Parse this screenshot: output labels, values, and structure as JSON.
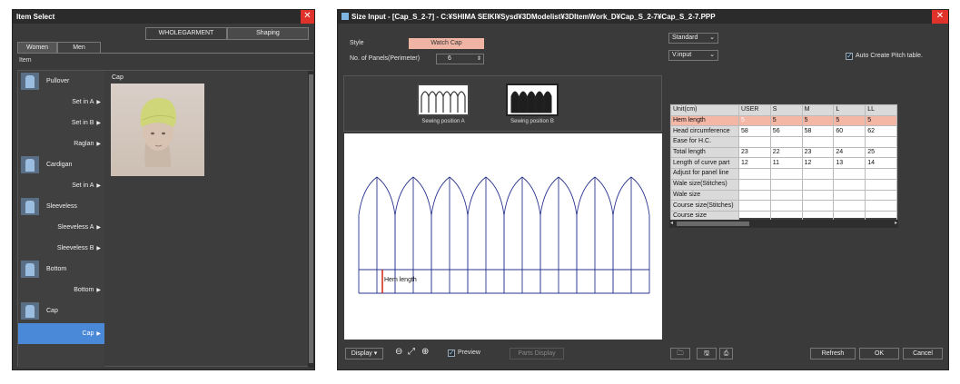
{
  "item_select": {
    "title": "Item Select",
    "close": "✕",
    "segments": [
      "WHOLEGARMENT",
      "Shaping"
    ],
    "tabs": [
      "Women",
      "Men"
    ],
    "item_label": "Item",
    "categories": [
      {
        "label": "Pullover"
      },
      {
        "label": "Cardigan"
      },
      {
        "label": "Sleeveless"
      },
      {
        "label": "Bottom"
      },
      {
        "label": "Cap"
      }
    ],
    "subitems": [
      "Set in A",
      "Set in B",
      "Raglan",
      "Set in A",
      "Sleeveless A",
      "Sleeveless B",
      "Bottom",
      "Cap"
    ],
    "arrow": "▶",
    "preview_title": "Cap"
  },
  "size_input": {
    "title": "Size Input - [Cap_S_2-7] - C:¥SHIMA SEIKI¥Sysd¥3DModelist¥3DItemWork_D¥Cap_S_2-7¥Cap_S_2-7.PPP",
    "close": "✕",
    "style_label": "Style",
    "style_value": "Watch Cap",
    "panels_label": "No. of Panels(Perimeter)",
    "panels_value": "6",
    "spin": "⇕",
    "sewing_a": "Sewing position A",
    "sewing_b": "Sewing position B",
    "hem_label": "Hem length",
    "standard": "Standard",
    "vinput": "V.input",
    "auto_pitch": "Auto Create Pitch table.",
    "display": "Display",
    "preview": "Preview",
    "parts_display": "Parts Display",
    "refresh": "Refresh",
    "ok": "OK",
    "cancel": "Cancel",
    "table": {
      "headers": [
        "Unit(cm)",
        "USER",
        "S",
        "M",
        "L",
        "LL"
      ],
      "rows": [
        [
          "Hem length",
          "5",
          "5",
          "5",
          "5",
          "5"
        ],
        [
          "Head circumference",
          "58",
          "56",
          "58",
          "60",
          "62"
        ],
        [
          "Ease for H.C.",
          "",
          "",
          "",
          "",
          ""
        ],
        [
          "Total length",
          "23",
          "22",
          "23",
          "24",
          "25"
        ],
        [
          "Length of curve part",
          "12",
          "11",
          "12",
          "13",
          "14"
        ],
        [
          "Adjust for panel line",
          "",
          "",
          "",
          "",
          ""
        ],
        [
          "Wale size(Stitches)",
          "",
          "",
          "",
          "",
          ""
        ],
        [
          "Wale size",
          "",
          "",
          "",
          "",
          ""
        ],
        [
          "Course size(Stitches)",
          "",
          "",
          "",
          "",
          ""
        ],
        [
          "Course size",
          "",
          "",
          "",
          "",
          ""
        ]
      ]
    }
  }
}
